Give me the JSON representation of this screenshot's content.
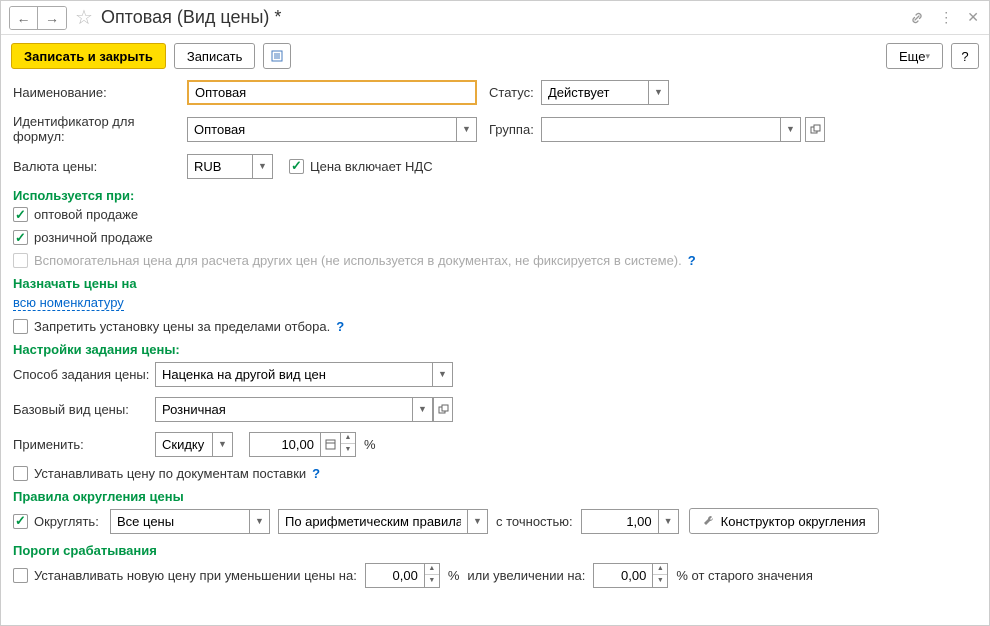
{
  "header": {
    "title": "Оптовая (Вид цены) *"
  },
  "toolbar": {
    "save_close": "Записать и закрыть",
    "save": "Записать",
    "more": "Еще",
    "help": "?"
  },
  "form": {
    "name_label": "Наименование:",
    "name_value": "Оптовая",
    "status_label": "Статус:",
    "status_value": "Действует",
    "formula_id_label": "Идентификатор для формул:",
    "formula_id_value": "Оптовая",
    "group_label": "Группа:",
    "group_value": "",
    "currency_label": "Валюта цены:",
    "currency_value": "RUB",
    "vat_label": "Цена включает НДС"
  },
  "usage": {
    "title": "Используется при:",
    "wholesale": "оптовой продаже",
    "retail": "розничной продаже",
    "auxiliary": "Вспомогательная цена для расчета других цен (не используется в документах, не фиксируется в системе)."
  },
  "assign": {
    "title": "Назначать цены на",
    "link": "всю номенклатуру",
    "forbid": "Запретить установку цены за пределами отбора."
  },
  "settings": {
    "title": "Настройки задания цены:",
    "method_label": "Способ задания цены:",
    "method_value": "Наценка на другой вид цен",
    "base_label": "Базовый вид цены:",
    "base_value": "Розничная",
    "apply_label": "Применить:",
    "apply_value": "Скидку",
    "apply_amount": "10,00",
    "percent": "%",
    "by_docs": "Устанавливать цену по документам поставки"
  },
  "rounding": {
    "title": "Правила округления цены",
    "round_label": "Округлять:",
    "scope_value": "Все цены",
    "rule_value": "По арифметическим правилам",
    "precision_label": "с точностью:",
    "precision_value": "1,00",
    "constructor": "Конструктор округления"
  },
  "thresholds": {
    "title": "Пороги срабатывания",
    "decrease_label": "Устанавливать новую цену при уменьшении цены на:",
    "decrease_value": "0,00",
    "percent": "%",
    "increase_label": "или увеличении на:",
    "increase_value": "0,00",
    "suffix": "% от старого значения"
  }
}
